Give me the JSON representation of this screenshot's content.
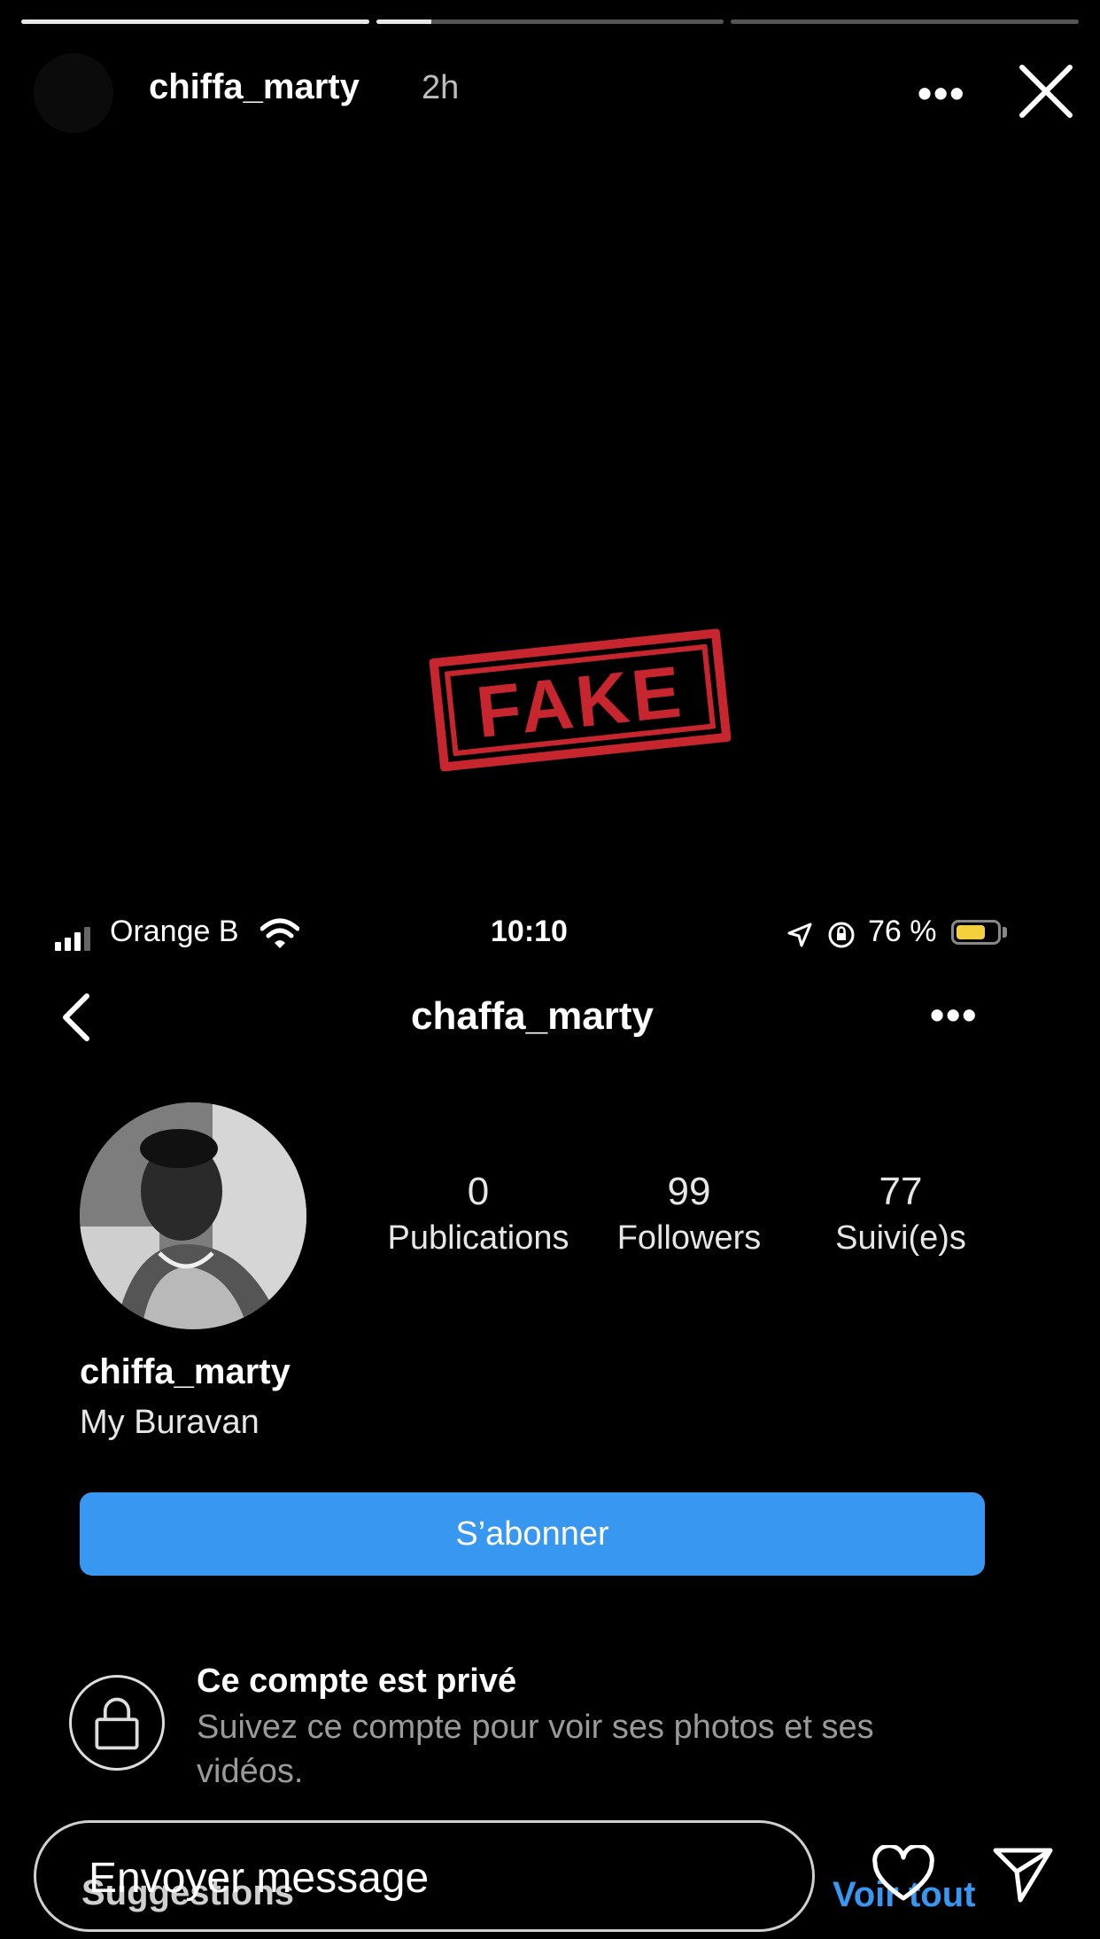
{
  "story": {
    "username": "chiffa_marty",
    "time": "2h",
    "more": "•••",
    "progress": [
      1.0,
      0.16,
      0.0
    ],
    "reply_placeholder": "Envoyer message"
  },
  "stamp": {
    "text": "FAKE",
    "color": "#c8262f"
  },
  "status_bar": {
    "carrier": "Orange B",
    "time": "10:10",
    "battery_text": "76 %",
    "battery_level": 0.76,
    "battery_color": "#f4d03f"
  },
  "profile": {
    "handle": "chaffa_marty",
    "more": "•••",
    "stats": [
      {
        "value": "0",
        "label": "Publications"
      },
      {
        "value": "99",
        "label": "Followers"
      },
      {
        "value": "77",
        "label": "Suivi(e)s"
      }
    ],
    "name": "chiffa_marty",
    "bio": "My Buravan",
    "follow_button": "S’abonner",
    "private_title": "Ce compte est privé",
    "private_desc": "Suivez ce compte pour voir ses photos et ses vidéos.",
    "suggestions": "Suggestions",
    "see_all": "Voir tout",
    "accent": "#3897f0"
  }
}
